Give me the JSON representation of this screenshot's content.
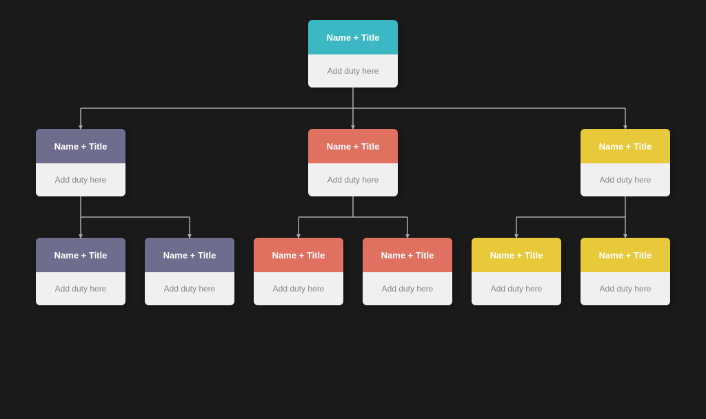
{
  "colors": {
    "teal": "#3bb8c3",
    "purple": "#6e6d8e",
    "red": "#e07060",
    "yellow": "#e8c93a",
    "card_bg": "#f0f0f0",
    "connector": "#aaaaaa",
    "bg": "#1a1a1a"
  },
  "root": {
    "name_title": "Name + Title",
    "duty": "Add duty here",
    "color": "teal"
  },
  "level1": [
    {
      "name_title": "Name + Title",
      "duty": "Add duty here",
      "color": "purple"
    },
    {
      "name_title": "Name + Title",
      "duty": "Add duty here",
      "color": "red"
    },
    {
      "name_title": "Name + Title",
      "duty": "Add duty here",
      "color": "yellow"
    }
  ],
  "level2": [
    {
      "name_title": "Name + Title",
      "duty": "Add duty here",
      "color": "purple",
      "parent": 0
    },
    {
      "name_title": "Name + Title",
      "duty": "Add duty here",
      "color": "purple",
      "parent": 0
    },
    {
      "name_title": "Name + Title",
      "duty": "Add duty here",
      "color": "red",
      "parent": 1
    },
    {
      "name_title": "Name + Title",
      "duty": "Add duty here",
      "color": "red",
      "parent": 1
    },
    {
      "name_title": "Name + Title",
      "duty": "Add duty here",
      "color": "yellow",
      "parent": 2
    },
    {
      "name_title": "Name + Title",
      "duty": "Add duty here",
      "color": "yellow",
      "parent": 2
    }
  ]
}
